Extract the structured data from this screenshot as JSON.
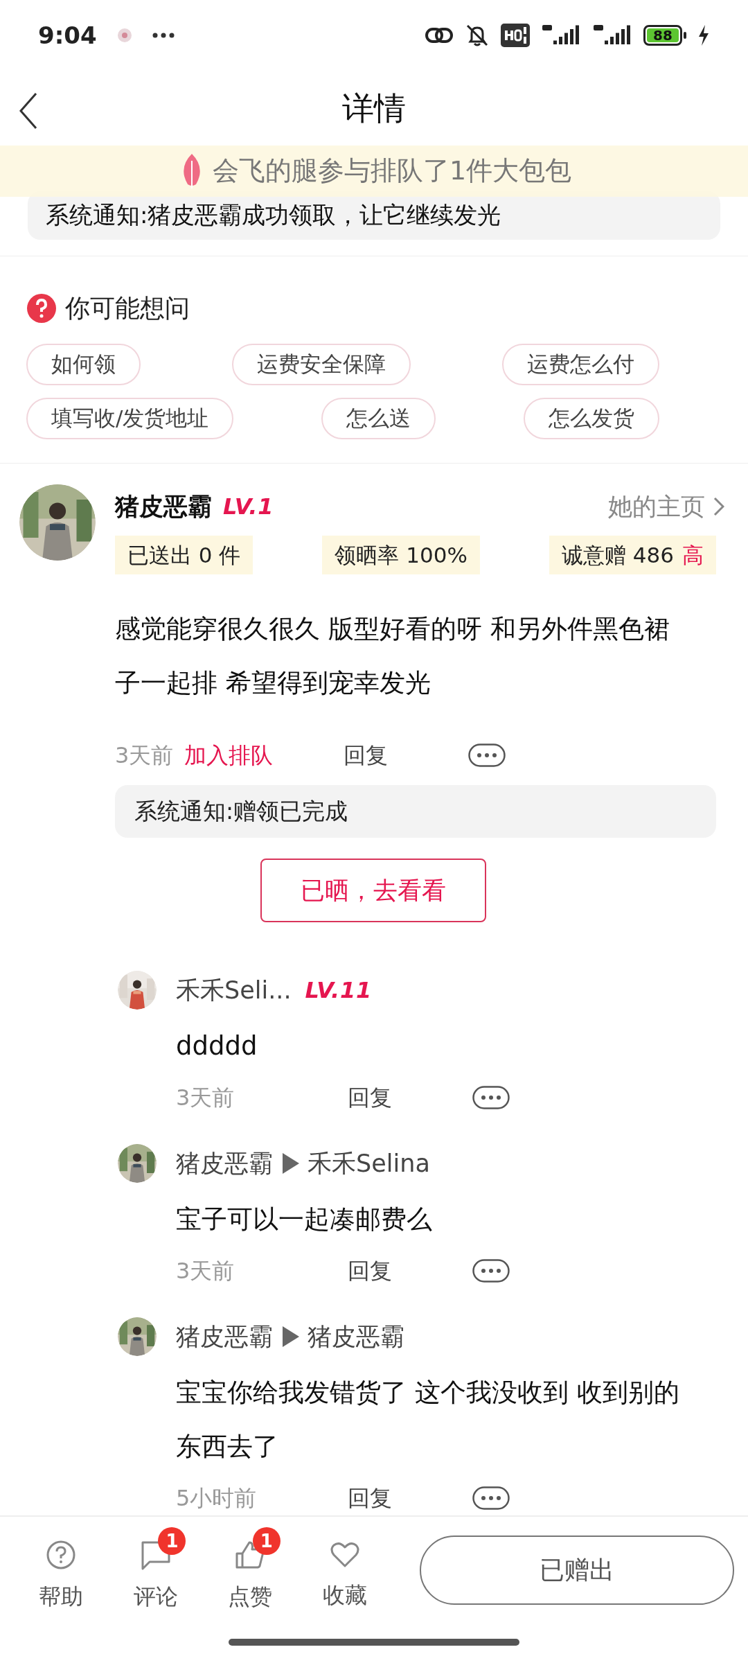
{
  "status_bar": {
    "time": "9:04",
    "battery": "88"
  },
  "header": {
    "title": "详情"
  },
  "toast": {
    "text": "会飞的腿参与排队了1件大包包"
  },
  "top_notice": {
    "text": "系统通知:猪皮恶霸成功领取，让它继续发光"
  },
  "faq": {
    "title": "你可能想问",
    "chips": [
      [
        "如何领",
        "运费安全保障",
        "运费怎么付"
      ],
      [
        "填写收/发货地址",
        "怎么送",
        "怎么发货"
      ]
    ]
  },
  "post": {
    "name": "猪皮恶霸",
    "level": "LV.1",
    "profile_link": "她的主页",
    "stats": [
      {
        "label": "已送出 0 件"
      },
      {
        "label": "领晒率 100%"
      },
      {
        "label": "诚意赠 486",
        "badge": "高"
      }
    ],
    "text": "感觉能穿很久很久 版型好看的呀 和另外件黑色裙子一起排 希望得到宠幸发光",
    "time": "3天前",
    "action": "加入排队",
    "reply": "回复",
    "notice": "系统通知:赠领已完成",
    "button": "已晒，去看看"
  },
  "replies": [
    {
      "name": "禾禾Seli...",
      "level": "LV.11",
      "text": "ddddd",
      "time": "3天前",
      "reply": "回复"
    },
    {
      "name": "猪皮恶霸",
      "target": "禾禾Selina",
      "text": "宝子可以一起凑邮费么",
      "time": "3天前",
      "reply": "回复"
    },
    {
      "name": "猪皮恶霸",
      "target": "猪皮恶霸",
      "text": "宝宝你给我发错货了 这个我没收到 收到别的东西去了",
      "time": "5小时前",
      "reply": "回复"
    }
  ],
  "bottom_bar": {
    "items": [
      {
        "kind": "help",
        "label": "帮助"
      },
      {
        "kind": "comment",
        "label": "评论",
        "badge": "1"
      },
      {
        "kind": "like",
        "label": "点赞",
        "badge": "1"
      },
      {
        "kind": "favorite",
        "label": "收藏"
      }
    ],
    "main_button": "已赠出"
  }
}
